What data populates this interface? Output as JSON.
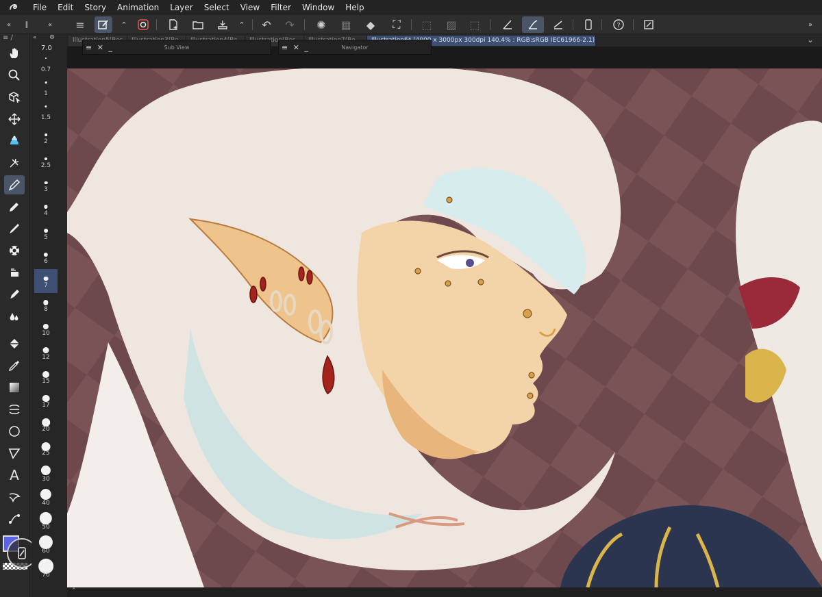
{
  "menubar": {
    "items": [
      "File",
      "Edit",
      "Story",
      "Animation",
      "Layer",
      "Select",
      "View",
      "Filter",
      "Window",
      "Help"
    ]
  },
  "tabs": [
    {
      "label": "Illustration5(Res"
    },
    {
      "label": "Illustration3(Re"
    },
    {
      "label": "Illustration4(Re"
    },
    {
      "label": "Illustration(Res"
    },
    {
      "label": "Illustration7(Re"
    },
    {
      "label": "Illustration6* (4000 x 3000px 300dpi 140.4% : RGB:sRGB IEC61966-2.1)"
    }
  ],
  "palettes": {
    "subview": {
      "title": "Sub View",
      "controls": "≡ ✕ _"
    },
    "navigator": {
      "title": "Navigator",
      "controls": "≡ ✕ _"
    }
  },
  "brush": {
    "current_size": "7.0",
    "sizes": [
      "0.7",
      "1",
      "1.5",
      "2",
      "2.5",
      "3",
      "4",
      "5",
      "6",
      "7",
      "8",
      "10",
      "12",
      "15",
      "17",
      "20",
      "25",
      "30",
      "40",
      "50",
      "60",
      "70"
    ],
    "selected": "7"
  },
  "colors": {
    "main": "#5b63e0",
    "accent": "#4a5568",
    "active_tab": "#3d4f73"
  },
  "tools": [
    "hand-icon",
    "zoom-icon",
    "operation-icon",
    "move-icon",
    "fill-bucket-icon",
    "auto-select-icon",
    "pen-icon",
    "pencil-icon",
    "brush-icon",
    "decoration-icon",
    "eraser-icon",
    "inking-icon",
    "blend-icon",
    "fill-icon",
    "eyedropper-icon",
    "gradient-icon",
    "ruler-icon",
    "figure-icon",
    "frame-icon",
    "text-icon",
    "balloon-icon",
    "correct-line-icon"
  ]
}
